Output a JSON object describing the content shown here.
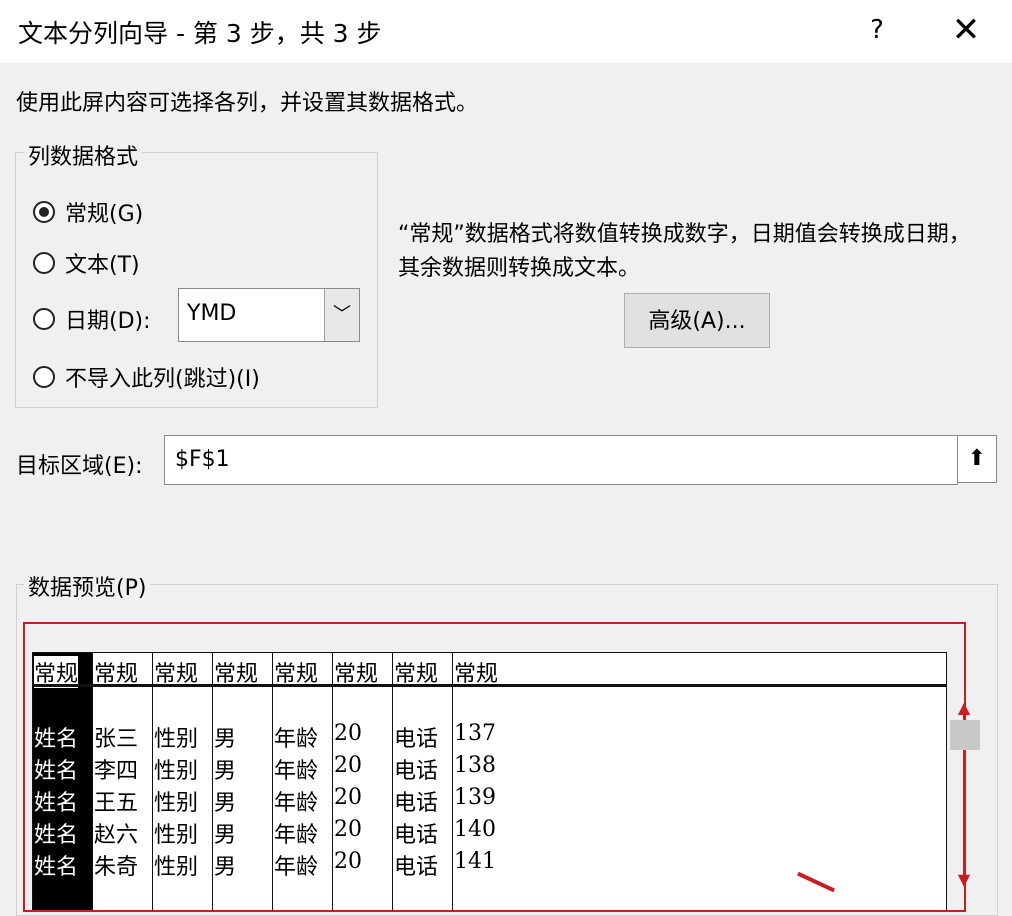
{
  "dialog": {
    "title": "文本分列向导 - 第 3 步，共 3 步",
    "help": "?",
    "close": "✕"
  },
  "instruction": "使用此屏内容可选择各列，并设置其数据格式。",
  "column_format": {
    "legend": "列数据格式",
    "options": [
      {
        "label": "常规(G)",
        "checked": true
      },
      {
        "label": "文本(T)",
        "checked": false
      },
      {
        "label": "日期(D):",
        "checked": false
      },
      {
        "label": "不导入此列(跳过)(I)",
        "checked": false
      }
    ],
    "date_format": "YMD"
  },
  "description": "“常规”数据格式将数值转换成数字，日期值会转换成日期，其余数据则转换成文本。",
  "advanced_button": "高级(A)...",
  "destination": {
    "label": "目标区域(E):",
    "value": "$F$1",
    "button_icon": "collapse-dialog-icon"
  },
  "preview": {
    "legend": "数据预览(P)",
    "headers": [
      "常规",
      "常规",
      "常规",
      "常规",
      "常规",
      "常规",
      "常规",
      "常规"
    ],
    "rows": [
      [
        "姓名",
        "张三",
        "性别",
        "男",
        "年龄",
        "20",
        "电话",
        "137"
      ],
      [
        "姓名",
        "李四",
        "性别",
        "男",
        "年龄",
        "20",
        "电话",
        "138"
      ],
      [
        "姓名",
        "王五",
        "性别",
        "男",
        "年龄",
        "20",
        "电话",
        "139"
      ],
      [
        "姓名",
        "赵六",
        "性别",
        "男",
        "年龄",
        "20",
        "电话",
        "140"
      ],
      [
        "姓名",
        "朱奇",
        "性别",
        "男",
        "年龄",
        "20",
        "电话",
        "141"
      ]
    ]
  },
  "colors": {
    "highlight_box": "#c91d24",
    "selected_column": "#000000"
  }
}
